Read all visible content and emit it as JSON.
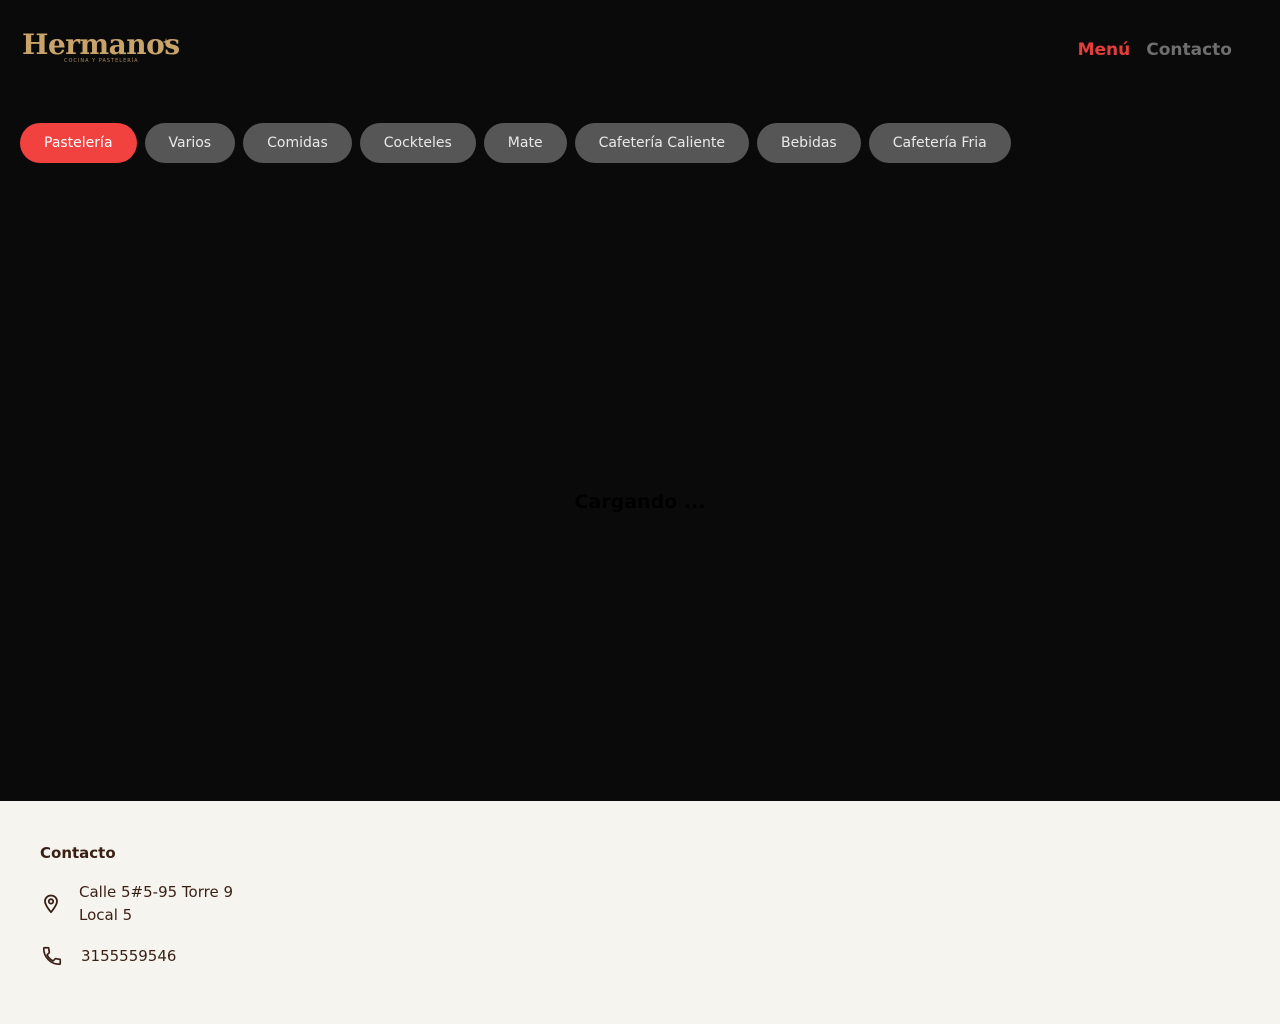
{
  "brand": {
    "name": "Hermanos",
    "tagline": "COCINA Y PASTELERÍA",
    "color": "#c9a46a"
  },
  "nav": {
    "menu_label": "Menú",
    "contact_label": "Contacto",
    "active_color": "#e53e3a",
    "inactive_color": "#6e6e6e"
  },
  "categories": [
    {
      "label": "Pastelería",
      "active": true
    },
    {
      "label": "Varios",
      "active": false
    },
    {
      "label": "Comidas",
      "active": false
    },
    {
      "label": "Cockteles",
      "active": false
    },
    {
      "label": "Mate",
      "active": false
    },
    {
      "label": "Cafetería Caliente",
      "active": false
    },
    {
      "label": "Bebidas",
      "active": false
    },
    {
      "label": "Cafetería Fria",
      "active": false
    }
  ],
  "main": {
    "loading_text": "Cargando ..."
  },
  "footer": {
    "title": "Contacto",
    "address_line1": "Calle 5#5-95 Torre 9",
    "address_line2": "Local 5",
    "phone": "3155559546",
    "address_icon": "location-pin-icon",
    "phone_icon": "phone-icon"
  },
  "colors": {
    "background": "#0a0a0b",
    "tab_active": "#f2423f",
    "tab_inactive": "#565656",
    "footer_bg": "#f6f4ef",
    "footer_text": "#3a1f14"
  }
}
